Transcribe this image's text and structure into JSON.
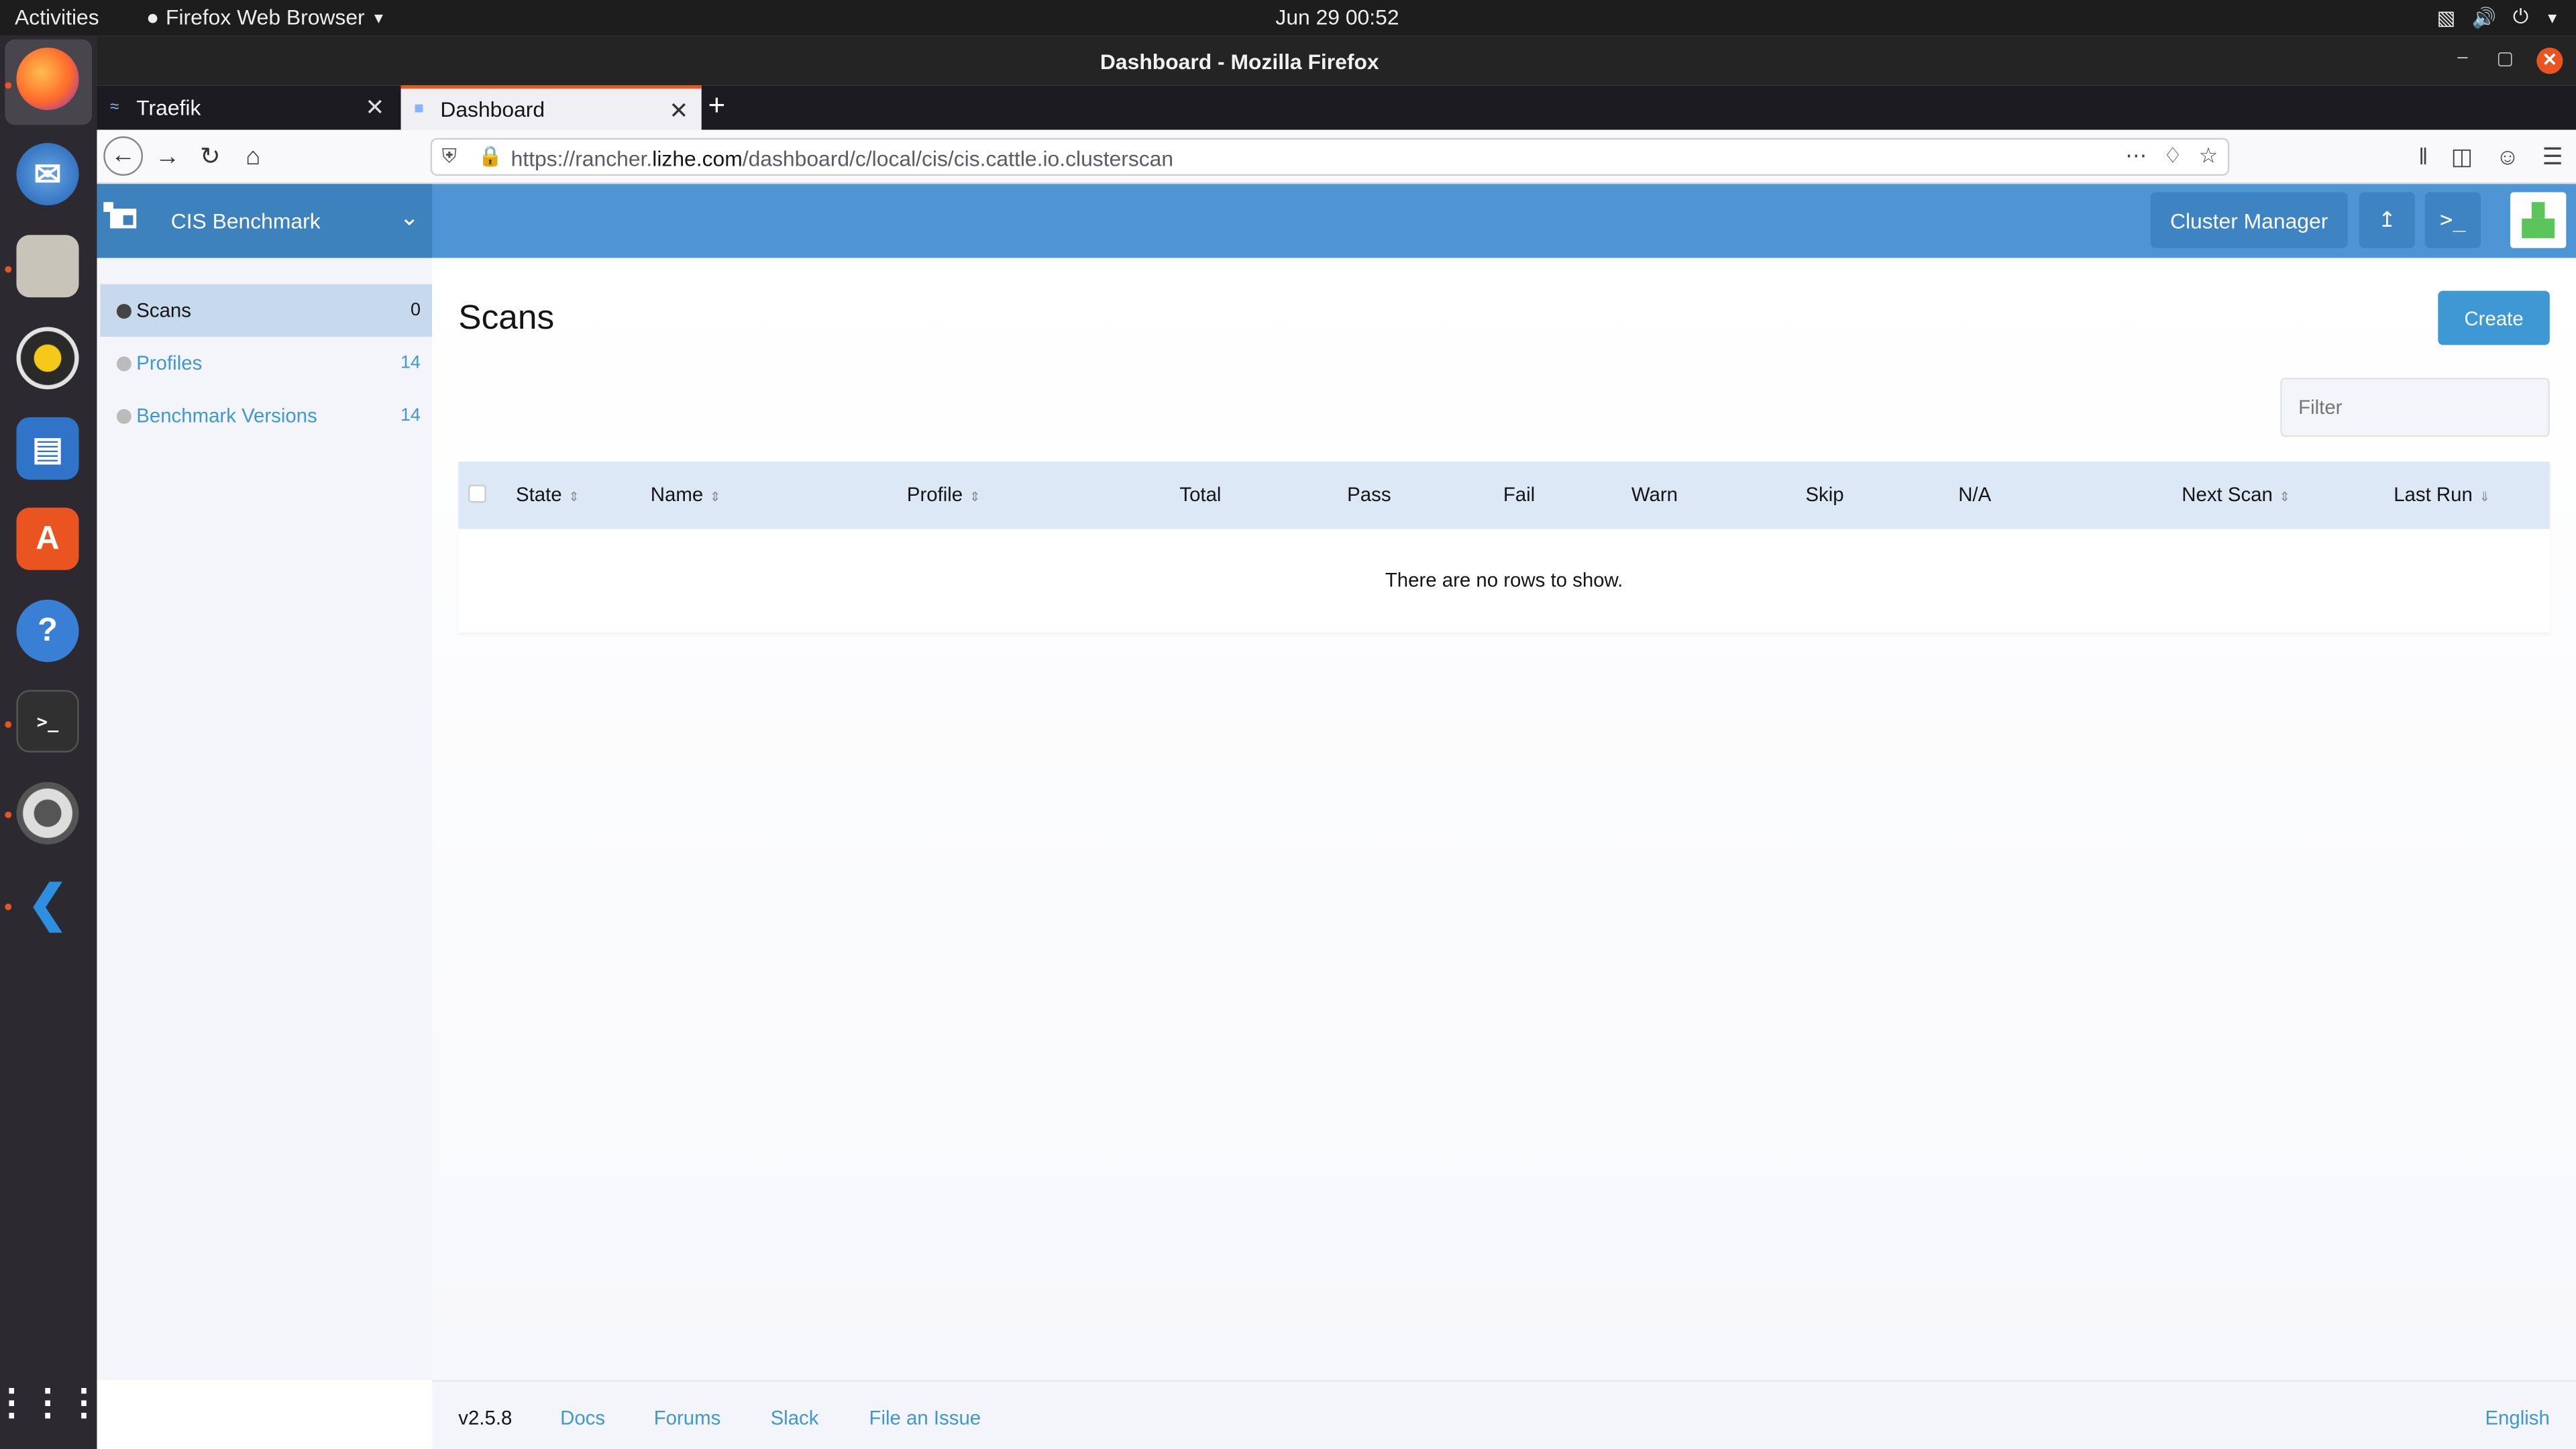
{
  "topbar": {
    "activities": "Activities",
    "app_name": "Firefox Web Browser",
    "clock": "Jun 29  00:52"
  },
  "window": {
    "title": "Dashboard - Mozilla Firefox"
  },
  "tabs": [
    {
      "label": "Traefik",
      "active": false
    },
    {
      "label": "Dashboard",
      "active": true
    }
  ],
  "url": {
    "prefix": "https://rancher.",
    "domain": "lizhe.com",
    "path": "/dashboard/c/local/cis/cis.cattle.io.clusterscan"
  },
  "header": {
    "product": "CIS Benchmark",
    "cluster_manager": "Cluster Manager"
  },
  "sidebar": {
    "items": [
      {
        "label": "Scans",
        "count": "0",
        "active": true
      },
      {
        "label": "Profiles",
        "count": "14",
        "active": false
      },
      {
        "label": "Benchmark Versions",
        "count": "14",
        "active": false
      }
    ]
  },
  "main": {
    "title": "Scans",
    "create_label": "Create",
    "filter_placeholder": "Filter",
    "columns": [
      "State",
      "Name",
      "Profile",
      "Total",
      "Pass",
      "Fail",
      "Warn",
      "Skip",
      "N/A",
      "Next Scan",
      "Last Run"
    ],
    "empty_text": "There are no rows to show."
  },
  "footer": {
    "version": "v2.5.8",
    "links": [
      "Docs",
      "Forums",
      "Slack",
      "File an Issue"
    ],
    "language": "English"
  },
  "colors": {
    "accent": "#3d98d3",
    "header": "#4d95d4",
    "ubuntu_orange": "#e95420"
  }
}
